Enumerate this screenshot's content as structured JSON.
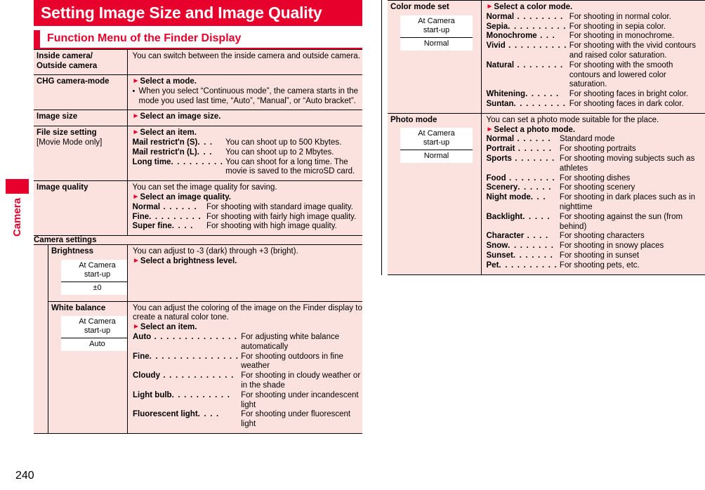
{
  "page": {
    "number": "240",
    "thumb_index_label": "Camera"
  },
  "heading": {
    "title": "Setting Image Size and Image Quality",
    "section": "Function Menu of the Finder Display"
  },
  "startup_header": "At Camera start-up",
  "left_table": {
    "rows": [
      {
        "label": "Inside camera/ Outside camera",
        "intro": "You can switch between the inside camera and outside camera."
      },
      {
        "label": "CHG camera-mode",
        "step": "Select a mode.",
        "bullet": "When you select “Continuous mode”, the camera starts in the mode you used last time, “Auto”, “Manual”, or “Auto bracket”."
      },
      {
        "label": "Image size",
        "step": "Select an image size."
      },
      {
        "label": "File size setting",
        "label_sub": "[Movie Mode only]",
        "step": "Select an item.",
        "defs": [
          {
            "term": "Mail restrict'n (S)",
            "leader": ". . .",
            "desc": "You can shoot up to 500 Kbytes."
          },
          {
            "term": "Mail restrict'n (L)",
            "leader": ". . .",
            "desc": "You can shoot up to 2 Mbytes."
          },
          {
            "term": "Long time",
            "leader": ". . . . . . . . .",
            "desc": "You can shoot for a long time. The movie is saved to the microSD card."
          }
        ]
      },
      {
        "label": "Image quality",
        "intro": "You can set the image quality for saving.",
        "step": "Select an image quality.",
        "defs": [
          {
            "term": "Normal",
            "leader": " . . . . . .",
            "desc": "For shooting with standard image quality."
          },
          {
            "term": "Fine",
            "leader": ". . . . . . . . .",
            "desc": "For shooting with fairly high image quality."
          },
          {
            "term": "Super fine",
            "leader": ". . . .",
            "desc": "For shooting with high image quality."
          }
        ]
      }
    ],
    "group": {
      "title": "Camera settings",
      "rows": [
        {
          "label": "Brightness",
          "startup_value": "±0",
          "intro": "You can adjust to -3 (dark) through +3 (bright).",
          "step": "Select a brightness level."
        },
        {
          "label": "White balance",
          "startup_value": "Auto",
          "intro": "You can adjust the coloring of the image on the Finder display to create a natural color tone.",
          "step": "Select an item.",
          "defs": [
            {
              "term": "Auto",
              "leader": " . . . . . . . . . . . . . .",
              "desc": "For adjusting white balance automatically"
            },
            {
              "term": "Fine",
              "leader": ". . . . . . . . . . . . . . .",
              "desc": "For shooting outdoors in fine weather"
            },
            {
              "term": "Cloudy",
              "leader": " . . . . . . . . . . . .",
              "desc": "For shooting in cloudy weather or in the shade"
            },
            {
              "term": "Light bulb",
              "leader": ". . . . . . . . . .",
              "desc": "For shooting under incandescent light"
            },
            {
              "term": "Fluorescent light",
              "leader": ". . . .",
              "desc": "For shooting under fluorescent light"
            }
          ]
        }
      ]
    }
  },
  "right_table": {
    "rows": [
      {
        "label": "Color mode set",
        "startup_value": "Normal",
        "step": "Select a color mode.",
        "defs": [
          {
            "term": "Normal",
            "leader": " . . . . . . . .",
            "desc": "For shooting in normal color."
          },
          {
            "term": "Sepia",
            "leader": ". . . . . . . . . .",
            "desc": "For shooting in sepia color."
          },
          {
            "term": "Monochrome",
            "leader": " . . .",
            "desc": "For shooting in monochrome."
          },
          {
            "term": "Vivid",
            "leader": " . . . . . . . . . .",
            "desc": "For shooting with the vivid contours and raised color saturation."
          },
          {
            "term": "Natural",
            "leader": " . . . . . . . .",
            "desc": "For shooting with the smooth contours and lowered color saturation."
          },
          {
            "term": "Whitening",
            "leader": ". . . . . .",
            "desc": "For shooting faces in bright color."
          },
          {
            "term": "Suntan",
            "leader": ". . . . . . . . .",
            "desc": "For shooting faces in dark color."
          }
        ]
      },
      {
        "label": "Photo mode",
        "startup_value": "Normal",
        "intro": "You can set a photo mode suitable for the place.",
        "step": "Select a photo mode.",
        "defs": [
          {
            "term": "Normal",
            "leader": " . . . . . .",
            "desc": "Standard mode"
          },
          {
            "term": "Portrait",
            "leader": " . . . . . .",
            "desc": "For shooting portraits"
          },
          {
            "term": "Sports",
            "leader": " . . . . . . .",
            "desc": "For shooting moving subjects such as athletes"
          },
          {
            "term": "Food",
            "leader": " . . . . . . . .",
            "desc": "For shooting dishes"
          },
          {
            "term": "Scenery",
            "leader": ". . . . . .",
            "desc": "For shooting scenery"
          },
          {
            "term": "Night mode",
            "leader": ". . .",
            "desc": "For shooting in dark places such as in nighttime"
          },
          {
            "term": "Backlight",
            "leader": ". . . . .",
            "desc": "For shooting against the sun (from behind)"
          },
          {
            "term": "Character",
            "leader": " . . . .",
            "desc": "For shooting characters"
          },
          {
            "term": "Snow",
            "leader": ". . . . . . . .",
            "desc": "For shooting in snowy places"
          },
          {
            "term": "Sunset",
            "leader": ". . . . . . .",
            "desc": "For shooting in sunset"
          },
          {
            "term": "Pet",
            "leader": ". . . . . . . . . .",
            "desc": "For shooting pets, etc."
          }
        ]
      }
    ]
  },
  "colors": {
    "accent_red": "#E8002D",
    "cell_pink": "#FCE2DE"
  }
}
